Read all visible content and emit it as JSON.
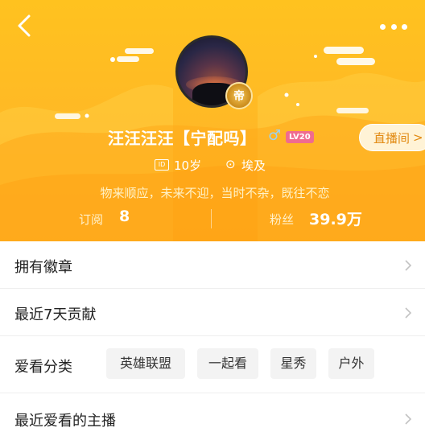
{
  "header": {
    "background_color": "#ffb826",
    "back_icon": "chevron-left-icon",
    "more_icon": "more-horizontal-icon"
  },
  "profile": {
    "avatar_badge_text": "帝",
    "username": "汪汪汪汪【宁配吗】",
    "gender_icon": "male-icon",
    "gender_symbol": "♂",
    "level": "LV20",
    "level_color": "#f06b8f",
    "live_room_label": "直播间",
    "live_room_chevron": ">",
    "id_icon_text": "ID",
    "age": "10岁",
    "location_icon": "location-pin-icon",
    "location_glyph": "⊙",
    "location": "埃及",
    "motto": "物来顺应，未来不迎，当时不杂，既往不恋"
  },
  "stats": {
    "subscribe_label": "订阅",
    "subscribe_value": "8",
    "fans_label": "粉丝",
    "fans_value": "39.9万"
  },
  "list": {
    "badges_title": "拥有徽章",
    "contribution_title": "最近7天贡献",
    "categories_title": "爱看分类",
    "categories": [
      "英雄联盟",
      "一起看",
      "星秀",
      "户外"
    ],
    "recent_streamers_title": "最近爱看的主播"
  }
}
